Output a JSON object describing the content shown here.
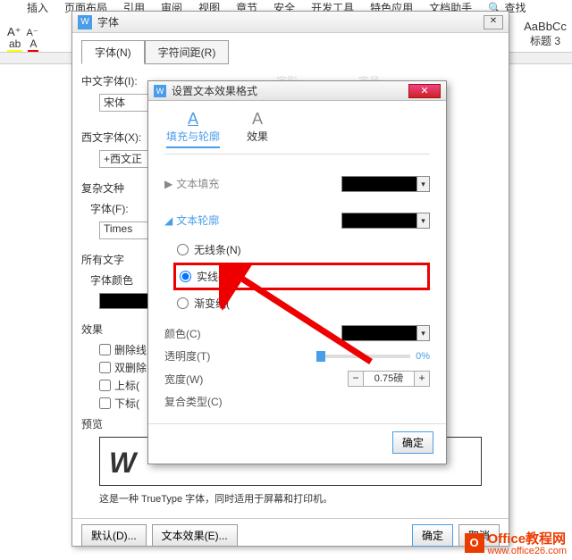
{
  "menu": {
    "items": [
      "插入",
      "页面布局",
      "引用",
      "审阅",
      "视图",
      "章节",
      "安全",
      "开发工具",
      "特色应用",
      "文档助手",
      "查找"
    ]
  },
  "toolbar": {
    "format": "A"
  },
  "style_panel": {
    "preview": "AaBbCc",
    "name": "标题 3"
  },
  "dialog_font": {
    "title": "字体",
    "close": "✕",
    "tabs": {
      "font": "字体(N)",
      "spacing": "字符间距(R)"
    },
    "labels": {
      "cn_font": "中文字体(I):",
      "cn_font_val": "宋体",
      "west_font": "西文字体(X):",
      "west_font_val": "+西文正",
      "complex": "复杂文种",
      "font_f": "字体(F):",
      "font_f_val": "Times",
      "all_text": "所有文字",
      "font_color": "字体颜色",
      "effects": "效果",
      "strike": "删除线",
      "dbl_strike": "双删除",
      "superscript": "上标(",
      "subscript": "下标(",
      "preview": "预览",
      "shape_hint": "字形",
      "size_hint": "字号"
    },
    "preview_text": "W",
    "note": "这是一种 TrueType 字体，同时适用于屏幕和打印机。",
    "buttons": {
      "default": "默认(D)...",
      "text_effect": "文本效果(E)...",
      "ok": "确定",
      "cancel": "取消"
    }
  },
  "dialog_effect": {
    "title": "设置文本效果格式",
    "close": "✕",
    "tabs": {
      "fill": "填充与轮廓",
      "effect": "效果"
    },
    "groups": {
      "text_fill": "文本填充",
      "text_outline": "文本轮廓"
    },
    "outline_options": {
      "none": "无线条(N)",
      "solid": "实线(S)",
      "gradient": "渐变线("
    },
    "controls": {
      "color": "颜色(C)",
      "transparency": "透明度(T)",
      "width": "宽度(W)",
      "compound": "复合类型(C)"
    },
    "values": {
      "transparency_pct": "0%",
      "width_val": "0.75磅"
    },
    "ok": "确定"
  },
  "watermark": {
    "badge": "O",
    "text1": "Office教程网",
    "text2": "www.office26.com"
  }
}
